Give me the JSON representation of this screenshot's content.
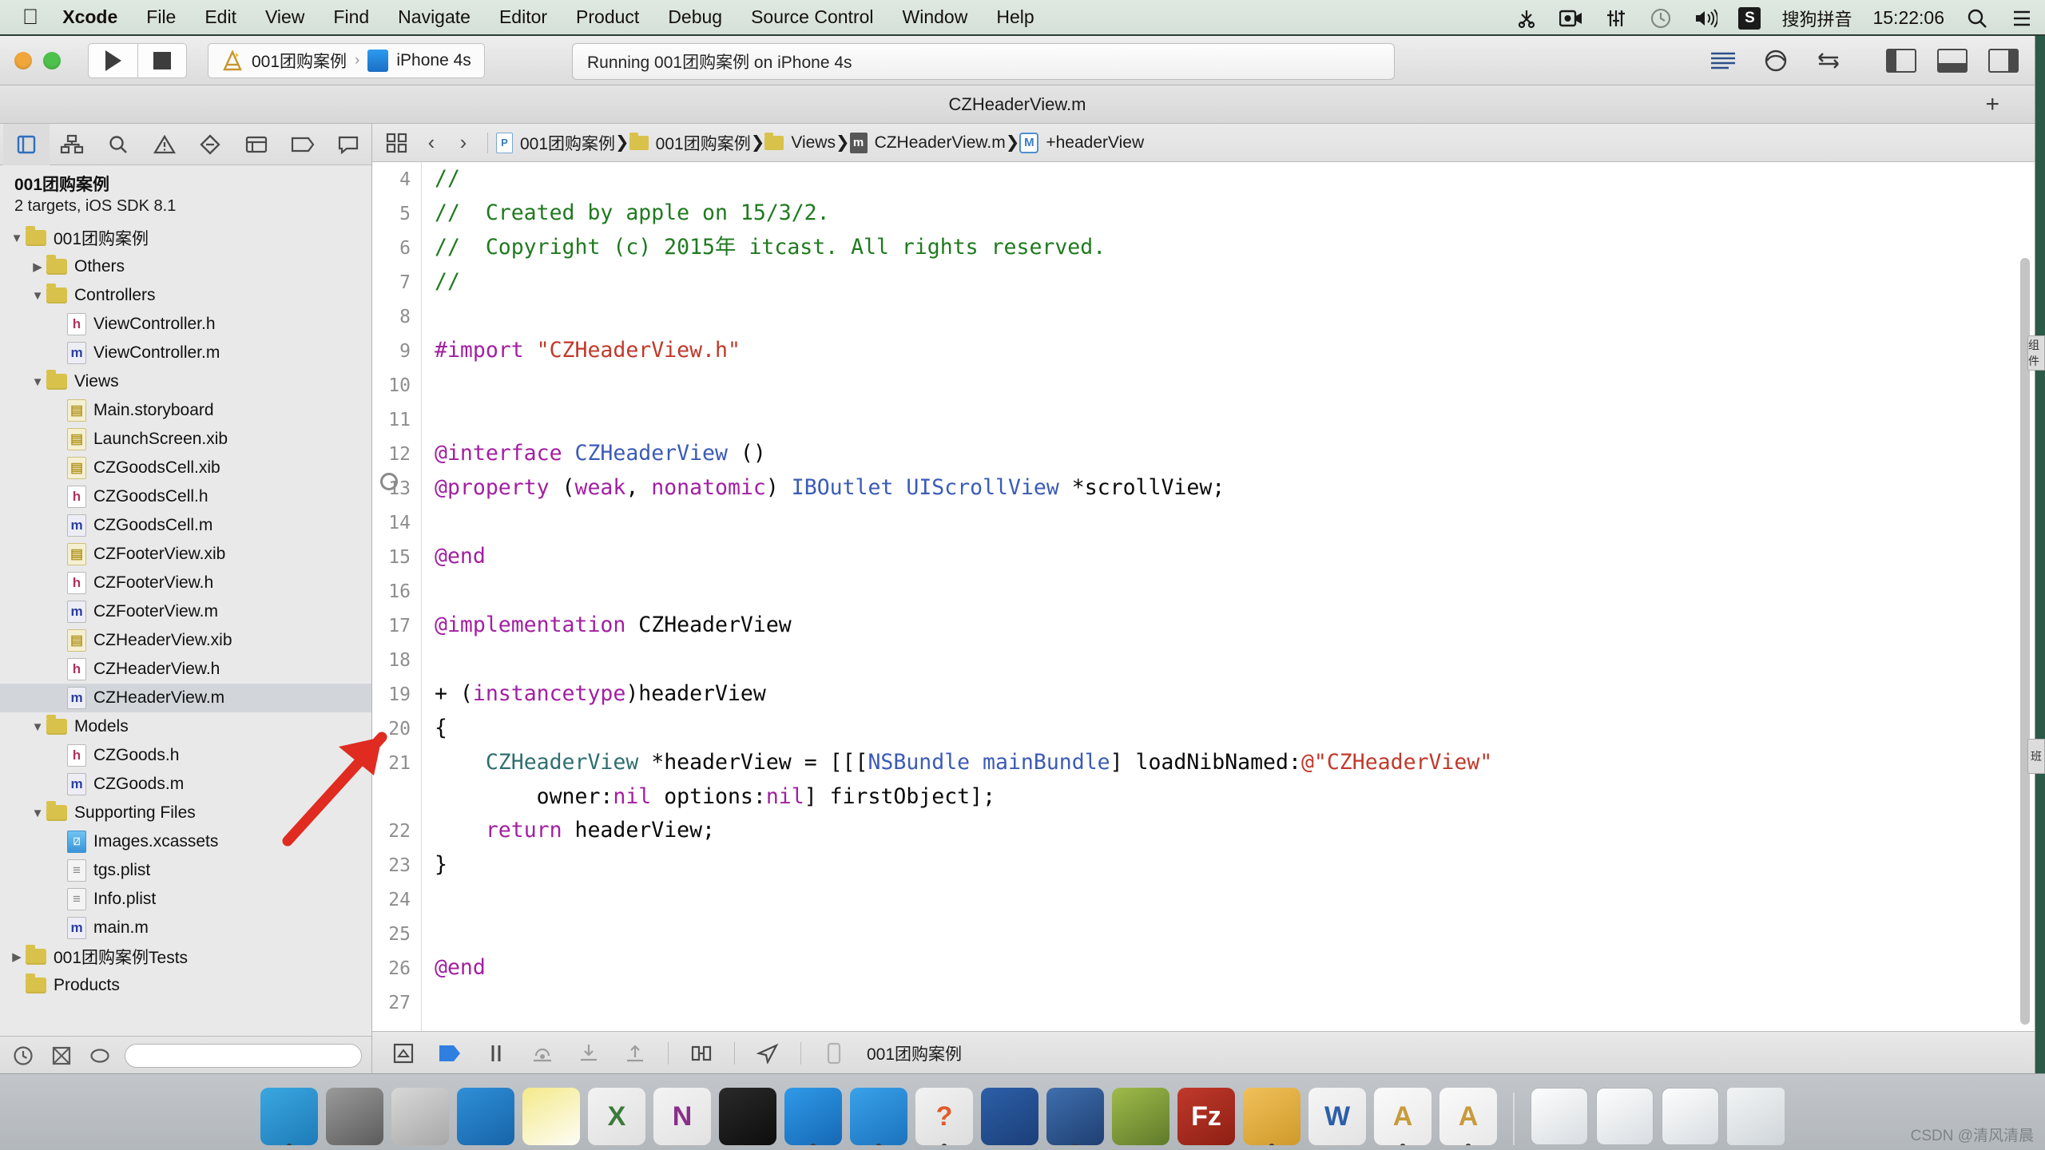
{
  "menubar": {
    "apple_icon": "apple-icon",
    "items": [
      {
        "label": "Xcode",
        "bold": true
      },
      {
        "label": "File",
        "bold": false
      },
      {
        "label": "Edit",
        "bold": false
      },
      {
        "label": "View",
        "bold": false
      },
      {
        "label": "Find",
        "bold": false
      },
      {
        "label": "Navigate",
        "bold": false
      },
      {
        "label": "Editor",
        "bold": false
      },
      {
        "label": "Product",
        "bold": false
      },
      {
        "label": "Debug",
        "bold": false
      },
      {
        "label": "Source Control",
        "bold": false
      },
      {
        "label": "Window",
        "bold": false
      },
      {
        "label": "Help",
        "bold": false
      }
    ],
    "tray": {
      "icons": [
        "scissors-icon",
        "screen-record-icon",
        "audio-mixer-icon",
        "time-machine-icon",
        "volume-icon"
      ],
      "sogou_badge": "S",
      "input_method": "搜狗拼音",
      "clock": "15:22:06",
      "search_icon": "search-icon",
      "notification_icon": "notification-center-icon"
    }
  },
  "toolbar": {
    "run_button": "run-button",
    "stop_button": "stop-button",
    "scheme": {
      "project": "001团购案例",
      "separator": "›",
      "destination": "iPhone 4s"
    },
    "activity_status": "Running 001团购案例 on iPhone 4s",
    "right_icons": [
      "standard-editor-icon",
      "assistant-editor-icon",
      "version-editor-icon"
    ],
    "panel_toggles": [
      "navigator-toggle",
      "debug-area-toggle",
      "utilities-toggle"
    ]
  },
  "editor_title": "CZHeaderView.m",
  "add_tab_label": "+",
  "navigator": {
    "tabs": [
      "project-navigator-icon",
      "symbol-navigator-icon",
      "search-navigator-icon",
      "issue-navigator-icon",
      "test-navigator-icon",
      "debug-navigator-icon",
      "breakpoint-navigator-icon",
      "report-navigator-icon"
    ],
    "project_name": "001团购案例",
    "project_subtitle": "2 targets, iOS SDK 8.1",
    "tree": [
      {
        "label": "001团购案例",
        "indent": 0,
        "kind": "folder",
        "twisty": "down",
        "selected": false
      },
      {
        "label": "Others",
        "indent": 1,
        "kind": "folder",
        "twisty": "right",
        "selected": false
      },
      {
        "label": "Controllers",
        "indent": 1,
        "kind": "folder",
        "twisty": "down",
        "selected": false
      },
      {
        "label": "ViewController.h",
        "indent": 2,
        "kind": "h",
        "twisty": "",
        "selected": false
      },
      {
        "label": "ViewController.m",
        "indent": 2,
        "kind": "m",
        "twisty": "",
        "selected": false
      },
      {
        "label": "Views",
        "indent": 1,
        "kind": "folder",
        "twisty": "down",
        "selected": false
      },
      {
        "label": "Main.storyboard",
        "indent": 2,
        "kind": "xib",
        "twisty": "",
        "selected": false
      },
      {
        "label": "LaunchScreen.xib",
        "indent": 2,
        "kind": "xib",
        "twisty": "",
        "selected": false
      },
      {
        "label": "CZGoodsCell.xib",
        "indent": 2,
        "kind": "xib",
        "twisty": "",
        "selected": false
      },
      {
        "label": "CZGoodsCell.h",
        "indent": 2,
        "kind": "h",
        "twisty": "",
        "selected": false
      },
      {
        "label": "CZGoodsCell.m",
        "indent": 2,
        "kind": "m",
        "twisty": "",
        "selected": false
      },
      {
        "label": "CZFooterView.xib",
        "indent": 2,
        "kind": "xib",
        "twisty": "",
        "selected": false
      },
      {
        "label": "CZFooterView.h",
        "indent": 2,
        "kind": "h",
        "twisty": "",
        "selected": false
      },
      {
        "label": "CZFooterView.m",
        "indent": 2,
        "kind": "m",
        "twisty": "",
        "selected": false
      },
      {
        "label": "CZHeaderView.xib",
        "indent": 2,
        "kind": "xib",
        "twisty": "",
        "selected": false
      },
      {
        "label": "CZHeaderView.h",
        "indent": 2,
        "kind": "h",
        "twisty": "",
        "selected": false
      },
      {
        "label": "CZHeaderView.m",
        "indent": 2,
        "kind": "m",
        "twisty": "",
        "selected": true
      },
      {
        "label": "Models",
        "indent": 1,
        "kind": "folder",
        "twisty": "down",
        "selected": false
      },
      {
        "label": "CZGoods.h",
        "indent": 2,
        "kind": "h",
        "twisty": "",
        "selected": false
      },
      {
        "label": "CZGoods.m",
        "indent": 2,
        "kind": "m",
        "twisty": "",
        "selected": false
      },
      {
        "label": "Supporting Files",
        "indent": 1,
        "kind": "folder",
        "twisty": "down",
        "selected": false
      },
      {
        "label": "Images.xcassets",
        "indent": 2,
        "kind": "assets",
        "twisty": "",
        "selected": false
      },
      {
        "label": "tgs.plist",
        "indent": 2,
        "kind": "plist",
        "twisty": "",
        "selected": false
      },
      {
        "label": "Info.plist",
        "indent": 2,
        "kind": "plist",
        "twisty": "",
        "selected": false
      },
      {
        "label": "main.m",
        "indent": 2,
        "kind": "m",
        "twisty": "",
        "selected": false
      },
      {
        "label": "001团购案例Tests",
        "indent": 0,
        "kind": "folder",
        "twisty": "right",
        "selected": false
      },
      {
        "label": "Products",
        "indent": 0,
        "kind": "folder",
        "twisty": "",
        "selected": false
      }
    ],
    "filter_icons": [
      "recent-files-icon",
      "source-control-icon",
      "filter-icon"
    ],
    "filter_placeholder": ""
  },
  "jumpbar": {
    "related_items_icon": "related-items-icon",
    "back_icon": "‹",
    "forward_icon": "›",
    "crumbs": [
      {
        "label": "001团购案例",
        "icon": "project-icon"
      },
      {
        "label": "001团购案例",
        "icon": "folder-icon"
      },
      {
        "label": "Views",
        "icon": "folder-icon"
      },
      {
        "label": "CZHeaderView.m",
        "icon": "m-file-icon"
      },
      {
        "label": "+headerView",
        "icon": "method-icon"
      }
    ]
  },
  "code": {
    "first_visible_line": 4,
    "breakpoint_line": 13,
    "lines": [
      {
        "n": 4,
        "tokens": [
          {
            "t": "//",
            "c": "cmt"
          }
        ]
      },
      {
        "n": 5,
        "tokens": [
          {
            "t": "//  Created by apple on 15/3/2.",
            "c": "cmt"
          }
        ]
      },
      {
        "n": 6,
        "tokens": [
          {
            "t": "//  Copyright (c) 2015年 itcast. All rights reserved.",
            "c": "cmt"
          }
        ]
      },
      {
        "n": 7,
        "tokens": [
          {
            "t": "//",
            "c": "cmt"
          }
        ]
      },
      {
        "n": 8,
        "tokens": []
      },
      {
        "n": 9,
        "tokens": [
          {
            "t": "#import ",
            "c": "pre"
          },
          {
            "t": "\"CZHeaderView.h\"",
            "c": "str"
          }
        ]
      },
      {
        "n": 10,
        "tokens": []
      },
      {
        "n": 11,
        "tokens": []
      },
      {
        "n": 12,
        "tokens": [
          {
            "t": "@interface ",
            "c": "kw"
          },
          {
            "t": "CZHeaderView",
            "c": "type"
          },
          {
            "t": " ()",
            "c": "plain"
          }
        ]
      },
      {
        "n": 13,
        "tokens": [
          {
            "t": "@property ",
            "c": "kw"
          },
          {
            "t": "(",
            "c": "plain"
          },
          {
            "t": "weak",
            "c": "kw"
          },
          {
            "t": ", ",
            "c": "plain"
          },
          {
            "t": "nonatomic",
            "c": "kw"
          },
          {
            "t": ") ",
            "c": "plain"
          },
          {
            "t": "IBOutlet UIScrollView",
            "c": "type"
          },
          {
            "t": " *scrollView;",
            "c": "plain"
          }
        ]
      },
      {
        "n": 14,
        "tokens": []
      },
      {
        "n": 15,
        "tokens": [
          {
            "t": "@end",
            "c": "kw"
          }
        ]
      },
      {
        "n": 16,
        "tokens": []
      },
      {
        "n": 17,
        "tokens": [
          {
            "t": "@implementation ",
            "c": "kw"
          },
          {
            "t": "CZHeaderView",
            "c": "plain"
          }
        ]
      },
      {
        "n": 18,
        "tokens": []
      },
      {
        "n": 19,
        "tokens": [
          {
            "t": "+ (",
            "c": "plain"
          },
          {
            "t": "instancetype",
            "c": "kw"
          },
          {
            "t": ")headerView",
            "c": "plain"
          }
        ]
      },
      {
        "n": 20,
        "tokens": [
          {
            "t": "{",
            "c": "plain"
          }
        ]
      },
      {
        "n": 21,
        "tokens": [
          {
            "t": "    ",
            "c": "plain"
          },
          {
            "t": "CZHeaderView",
            "c": "proj"
          },
          {
            "t": " *headerView = [[[",
            "c": "plain"
          },
          {
            "t": "NSBundle mainBundle",
            "c": "type"
          },
          {
            "t": "] loadNibNamed:",
            "c": "plain"
          },
          {
            "t": "@\"CZHeaderView\"",
            "c": "str"
          }
        ]
      },
      {
        "n": 0,
        "tokens": [
          {
            "t": "        owner:",
            "c": "plain"
          },
          {
            "t": "nil",
            "c": "kw"
          },
          {
            "t": " options:",
            "c": "plain"
          },
          {
            "t": "nil",
            "c": "kw"
          },
          {
            "t": "] firstObject];",
            "c": "plain"
          }
        ]
      },
      {
        "n": 22,
        "tokens": [
          {
            "t": "    ",
            "c": "plain"
          },
          {
            "t": "return",
            "c": "kw"
          },
          {
            "t": " headerView;",
            "c": "plain"
          }
        ]
      },
      {
        "n": 23,
        "tokens": [
          {
            "t": "}",
            "c": "plain"
          }
        ]
      },
      {
        "n": 24,
        "tokens": []
      },
      {
        "n": 25,
        "tokens": []
      },
      {
        "n": 26,
        "tokens": [
          {
            "t": "@end",
            "c": "kw"
          }
        ]
      },
      {
        "n": 27,
        "tokens": []
      }
    ]
  },
  "debugbar": {
    "icons": [
      "hide-debug-area-icon",
      "continue-icon",
      "pause-icon",
      "step-over-icon",
      "step-into-icon",
      "step-out-icon",
      "view-debug-icon",
      "location-simulate-icon",
      "process-icon"
    ],
    "process_label": "001团购案例"
  },
  "dock": {
    "items": [
      {
        "name": "finder-icon",
        "label": "",
        "color1": "#3aa7e0",
        "color2": "#1e7bb8",
        "running": true
      },
      {
        "name": "system-preferences-icon",
        "label": "",
        "color1": "#9a9a9a",
        "color2": "#5c5c5c",
        "running": false
      },
      {
        "name": "launchpad-icon",
        "label": "",
        "color1": "#d8d8d8",
        "color2": "#a8a8a8",
        "running": false
      },
      {
        "name": "safari-icon",
        "label": "",
        "color1": "#2f8fd8",
        "color2": "#1764a8",
        "running": false
      },
      {
        "name": "notes-icon",
        "label": "",
        "color1": "#f5e98a",
        "color2": "#fdfdf5",
        "running": false
      },
      {
        "name": "excel-icon",
        "label": "X",
        "color1": "#f2f2f2",
        "color2": "#e0e0e0",
        "running": false
      },
      {
        "name": "onenote-icon",
        "label": "N",
        "color1": "#f3f3f3",
        "color2": "#e2e2e2",
        "running": false
      },
      {
        "name": "terminal-icon",
        "label": "",
        "color1": "#2a2a2a",
        "color2": "#0d0d0d",
        "running": false
      },
      {
        "name": "xcode-icon",
        "label": "",
        "color1": "#2f9ae8",
        "color2": "#1668b5",
        "running": true
      },
      {
        "name": "simulator-icon",
        "label": "",
        "color1": "#39a2ea",
        "color2": "#1b72bd",
        "running": true
      },
      {
        "name": "preview-icon",
        "label": "?",
        "color1": "#f2f2f2",
        "color2": "#dddddd",
        "running": true
      },
      {
        "name": "snipaste-icon",
        "label": "",
        "color1": "#2c5fa8",
        "color2": "#1b3f78",
        "running": false
      },
      {
        "name": "quicktime-icon",
        "label": "",
        "color1": "#3f6fae",
        "color2": "#1f3f72",
        "running": true
      },
      {
        "name": "archive-utility-icon",
        "label": "",
        "color1": "#9fbb4a",
        "color2": "#5f7a2a",
        "running": false
      },
      {
        "name": "filezilla-icon",
        "label": "Fz",
        "color1": "#c0392b",
        "color2": "#8d1f14",
        "running": false
      },
      {
        "name": "paintbrush-icon",
        "label": "",
        "color1": "#f0c05a",
        "color2": "#d09a2a",
        "running": true
      },
      {
        "name": "word-icon",
        "label": "W",
        "color1": "#f5f5f5",
        "color2": "#e3e3e3",
        "running": false
      },
      {
        "name": "keynote-icon",
        "label": "A",
        "color1": "#fafafa",
        "color2": "#e8e8e8",
        "running": true
      },
      {
        "name": "pages-icon",
        "label": "A",
        "color1": "#fafafa",
        "color2": "#e8e8e8",
        "running": true
      }
    ],
    "minimized": [
      {
        "name": "minimized-window-1"
      },
      {
        "name": "minimized-window-2"
      },
      {
        "name": "minimized-window-3"
      }
    ],
    "trash": "trash-icon"
  },
  "rail_tabs": [
    {
      "label": "组件"
    },
    {
      "label": "班"
    }
  ],
  "watermark": "CSDN @清风清晨"
}
